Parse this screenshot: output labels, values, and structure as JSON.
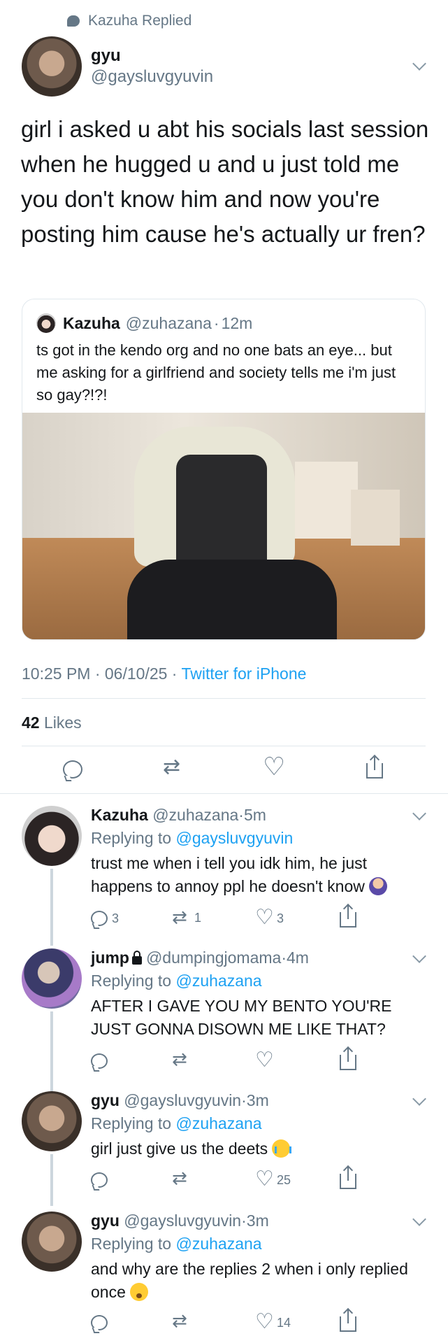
{
  "context": {
    "icon": "speech-bubble-icon",
    "text": "Kazuha Replied"
  },
  "main_tweet": {
    "name": "gyu",
    "handle": "@gaysluvgyuvin",
    "text": "girl i asked u abt his socials last session when he hugged u and u just told me you don't know him and now you're posting him cause he's actually ur fren?",
    "quote": {
      "name": "Kazuha",
      "handle": "@zuhazana",
      "sep": "·",
      "time": "12m",
      "text": "ts got in the kendo org and no one bats an eye... but me asking for a girlfriend and society tells me i'm just so gay?!?!"
    },
    "timestamp": "10:25 PM · 06/10/25 · ",
    "source": "Twitter for iPhone",
    "likes_count": "42",
    "likes_label": " Likes"
  },
  "replies": [
    {
      "name": "Kazuha",
      "handle": "@zuhazana",
      "sep": "·",
      "time": "5m",
      "replying_label": "Replying to ",
      "replying_to": "@gaysluvgyuvin",
      "text": "trust me when i tell you idk him, he just happens to annoy ppl he doesn't know",
      "emoji": "woman-shrugging-emoji",
      "reply_count": "3",
      "retweet_count": "1",
      "like_count": "3"
    },
    {
      "name": "jump",
      "handle": "@dumpingjomama",
      "sep": "·",
      "time": "4m",
      "replying_label": "Replying to ",
      "replying_to": "@zuhazana",
      "text": "AFTER I GAVE YOU MY BENTO YOU'RE JUST GONNA DISOWN ME LIKE THAT?",
      "reply_count": "",
      "retweet_count": "",
      "like_count": ""
    },
    {
      "name": "gyu",
      "handle": "@gaysluvgyuvin",
      "sep": "·",
      "time": "3m",
      "replying_label": "Replying to ",
      "replying_to": "@zuhazana",
      "text": "girl just give us the deets",
      "emoji": "loudly-crying-emoji",
      "reply_count": "",
      "retweet_count": "",
      "like_count": "25"
    },
    {
      "name": "gyu",
      "handle": "@gaysluvgyuvin",
      "sep": "·",
      "time": "3m",
      "replying_label": "Replying to ",
      "replying_to": "@zuhazana",
      "text": "and why are the replies 2 when i only replied once",
      "emoji": "worried-face-emoji",
      "reply_count": "",
      "retweet_count": "",
      "like_count": "14"
    }
  ],
  "colors": {
    "accent": "#1da1f2",
    "muted": "#657786",
    "text": "#14171a",
    "divider": "#e1e8ed"
  }
}
